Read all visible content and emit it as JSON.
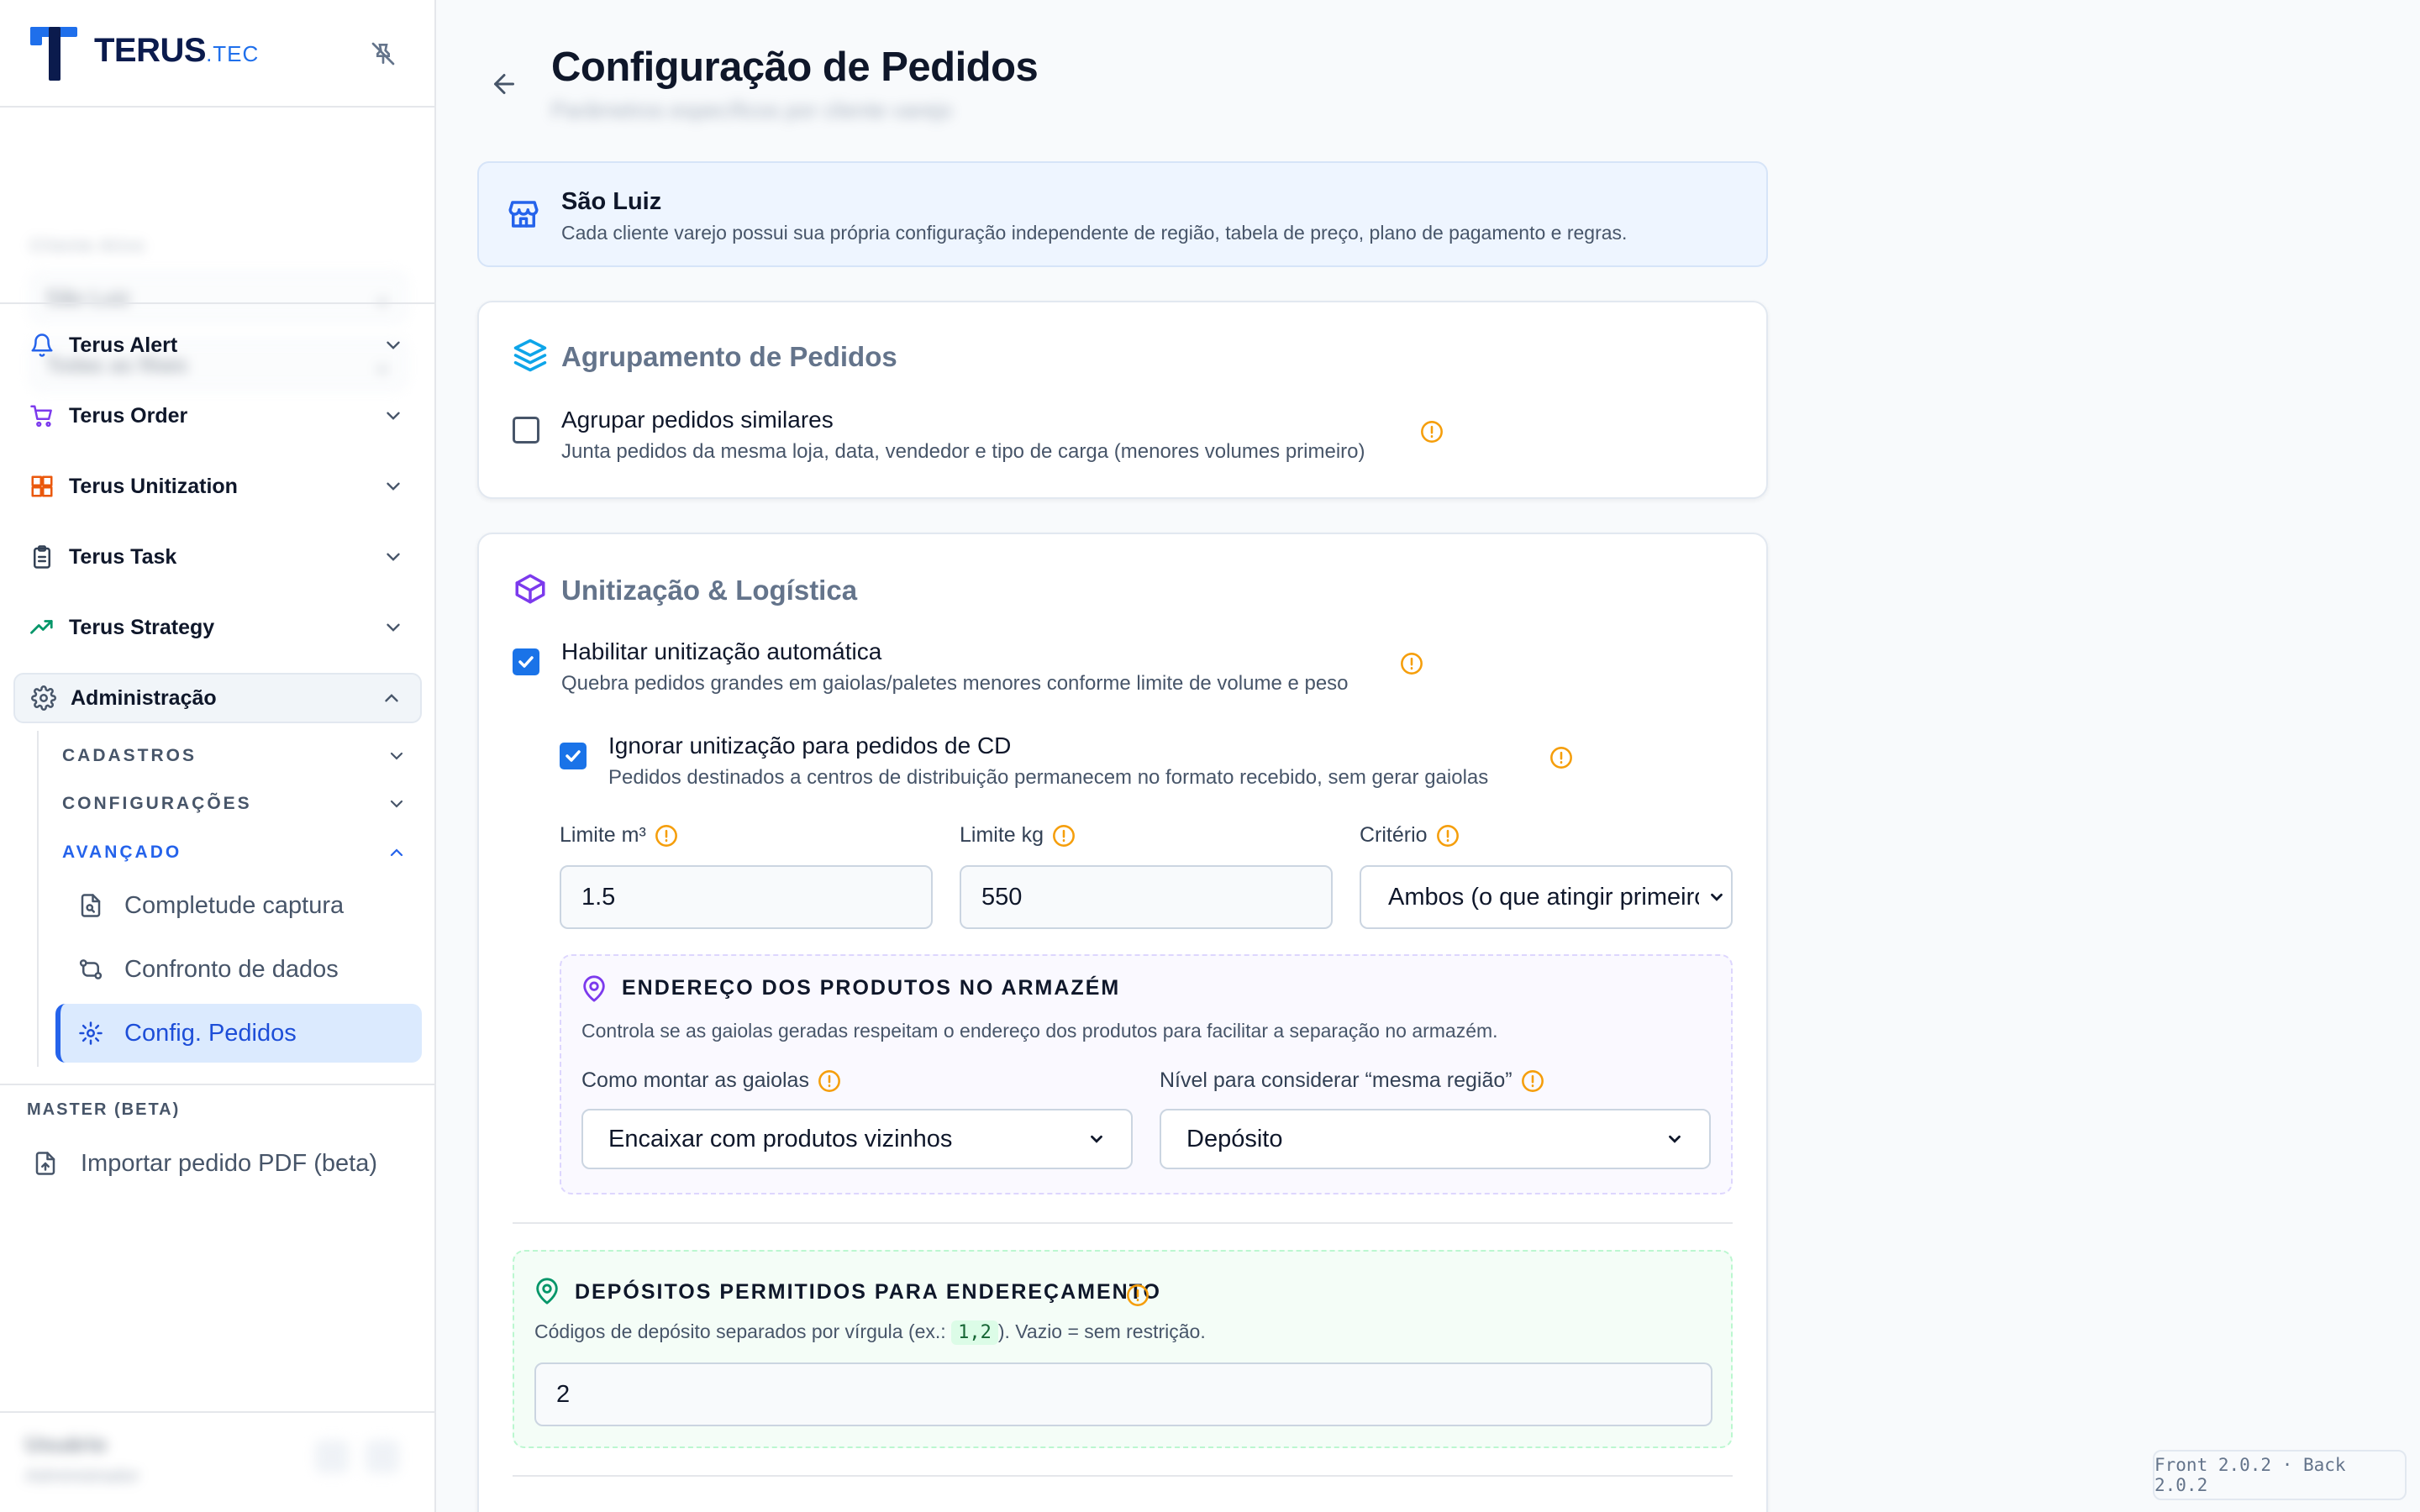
{
  "brand": {
    "name": "TERUS",
    "suffix": ".TEC"
  },
  "sidebar": {
    "context_label": "Cliente Ativo",
    "context_select_1": "São Luiz",
    "context_select_2": "Todas as filiais",
    "modules": [
      {
        "label": "Terus Alert",
        "icon": "bell-icon",
        "color": "#2563eb"
      },
      {
        "label": "Terus Order",
        "icon": "cart-icon",
        "color": "#7c3aed"
      },
      {
        "label": "Terus Unitization",
        "icon": "boxes-icon",
        "color": "#ea580c"
      },
      {
        "label": "Terus Task",
        "icon": "clipboard-icon",
        "color": "#334155"
      },
      {
        "label": "Terus Strategy",
        "icon": "trending-up-icon",
        "color": "#059669"
      },
      {
        "label": "Administração",
        "icon": "gear-icon",
        "color": "#475569"
      }
    ],
    "admin_groups": [
      {
        "label": "CADASTROS"
      },
      {
        "label": "CONFIGURAÇÕES"
      },
      {
        "label": "AVANÇADO"
      }
    ],
    "advanced_items": [
      {
        "label": "Completude captura",
        "icon": "file-search-icon"
      },
      {
        "label": "Confronto de dados",
        "icon": "git-compare-icon"
      },
      {
        "label": "Config. Pedidos",
        "icon": "gear-icon"
      }
    ],
    "master_label": "MASTER (BETA)",
    "import_item": "Importar pedido PDF (beta)",
    "user": {
      "name": "Usuário",
      "role": "Administrador"
    }
  },
  "page": {
    "title": "Configuração de Pedidos",
    "subtitle": "Parâmetros específicos por cliente varejo"
  },
  "client_info": {
    "name": "São Luiz",
    "description": "Cada cliente varejo possui sua própria configuração independente de região, tabela de preço, plano de pagamento e regras."
  },
  "grouping": {
    "title": "Agrupamento de Pedidos",
    "option_title": "Agrupar pedidos similares",
    "option_desc": "Junta pedidos da mesma loja, data, vendedor e tipo de carga (menores volumes primeiro)",
    "checked": false
  },
  "unitization": {
    "title": "Unitização & Logística",
    "auto_title": "Habilitar unitização automática",
    "auto_desc": "Quebra pedidos grandes em gaiolas/paletes menores conforme limite de volume e peso",
    "auto_checked": true,
    "ignore_cd_title": "Ignorar unitização para pedidos de CD",
    "ignore_cd_desc": "Pedidos destinados a centros de distribuição permanecem no formato recebido, sem gerar gaiolas",
    "ignore_cd_checked": true,
    "limit_m3_label": "Limite m³",
    "limit_m3_value": "1.5",
    "limit_kg_label": "Limite kg",
    "limit_kg_value": "550",
    "criterion_label": "Critério",
    "criterion_value": "Ambos (o que atingir primeiro)"
  },
  "warehouse": {
    "title": "ENDEREÇO DOS PRODUTOS NO ARMAZÉM",
    "description": "Controla se as gaiolas geradas respeitam o endereço dos produtos para facilitar a separação no armazém.",
    "assembly_label": "Como montar as gaiolas",
    "assembly_value": "Encaixar com produtos vizinhos",
    "level_label": "Nível para considerar “mesma região”",
    "level_value": "Depósito"
  },
  "deposits": {
    "title": "DEPÓSITOS PERMITIDOS PARA ENDEREÇAMENTO",
    "desc_prefix": "Códigos de depósito separados por vírgula (ex.: ",
    "desc_example": "1,2",
    "desc_suffix": "). Vazio = sem restrição.",
    "value": "2"
  },
  "version": "Front 2.0.2 · Back 2.0.2",
  "colors": {
    "primary": "#1a73e8",
    "warning": "#f59e0b",
    "active_bg": "#dbeafe",
    "purple": "#7c3aed",
    "green": "#059669"
  }
}
